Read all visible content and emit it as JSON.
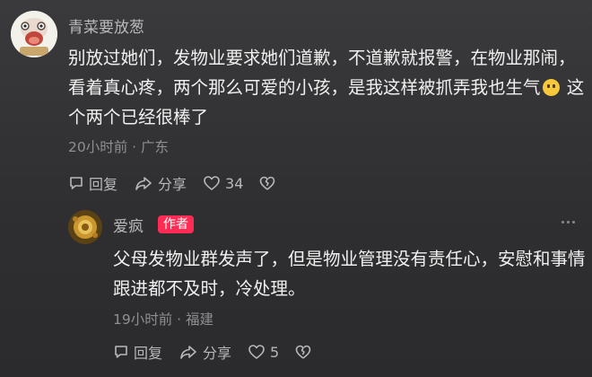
{
  "comments": [
    {
      "username": "青菜要放葱",
      "text_before_emoji": "别放过她们，发物业要求她们道歉，不道歉就报警，在物业那闹，看着真心疼，两个那么可爱的小孩，是我这样被抓弄我也生气",
      "emoji": "pleading-face-emoji",
      "text_after_emoji": " 这个两个已经很棒了",
      "meta": "20小时前 · 广东",
      "reply_label": "回复",
      "share_label": "分享",
      "like_count": "34"
    },
    {
      "username": "爱疯",
      "badge": "作者",
      "text": "父母发物业群发声了，但是物业管理没有责任心，安慰和事情跟进都不及时，冷处理。",
      "meta": "19小时前 · 福建",
      "reply_label": "回复",
      "share_label": "分享",
      "like_count": "5"
    }
  ],
  "colors": {
    "background": "#333335",
    "badge": "#fe2c55",
    "meta_text": "#8f8f92"
  },
  "icons": [
    "reply-icon",
    "share-icon",
    "heart-icon",
    "dislike-icon",
    "more-icon"
  ]
}
